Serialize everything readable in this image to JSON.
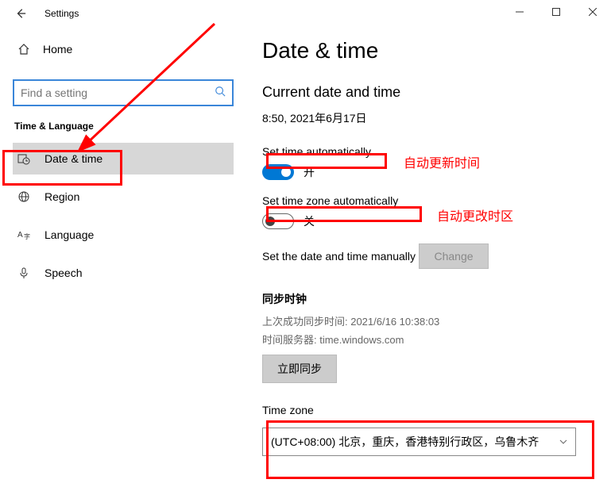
{
  "window": {
    "title": "Settings"
  },
  "sidebar": {
    "home": "Home",
    "search_placeholder": "Find a setting",
    "category": "Time & Language",
    "items": [
      {
        "label": "Date & time"
      },
      {
        "label": "Region"
      },
      {
        "label": "Language"
      },
      {
        "label": "Speech"
      }
    ]
  },
  "page": {
    "title": "Date & time",
    "current_heading": "Current date and time",
    "current_value": "8:50, 2021年6月17日",
    "auto_time_label": "Set time automatically",
    "auto_time_state": "开",
    "auto_tz_label": "Set time zone automatically",
    "auto_tz_state": "关",
    "manual_label": "Set the date and time manually",
    "change_btn": "Change",
    "sync_heading": "同步时钟",
    "sync_last": "上次成功同步时间: 2021/6/16 10:38:03",
    "sync_server": "时间服务器: time.windows.com",
    "sync_btn": "立即同步",
    "tz_label": "Time zone",
    "tz_value": "(UTC+08:00) 北京，重庆，香港特别行政区，乌鲁木齐"
  },
  "annotations": {
    "auto_time": "自动更新时间",
    "auto_tz": "自动更改时区"
  }
}
